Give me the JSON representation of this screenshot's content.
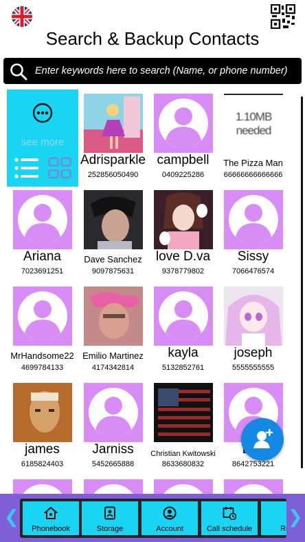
{
  "header": {
    "title": "Search & Backup Contacts",
    "language_icon": "uk-flag-icon",
    "qr_icon": "qr-code-icon"
  },
  "search": {
    "placeholder": "Enter keywords here to search (Name, or phone number)"
  },
  "see_more": {
    "label": "see more",
    "color": "#19d4f3"
  },
  "contacts": [
    {
      "name": "Adrisparkle",
      "phone": "252856050490",
      "photo": "photo"
    },
    {
      "name": "campbell",
      "phone": "0409225286",
      "photo": "default-avatar"
    },
    {
      "name": "The Pizza Man",
      "phone": "66666666666666",
      "photo": "photo"
    },
    {
      "name": "Ariana",
      "phone": "7023691251",
      "photo": "default-avatar"
    },
    {
      "name": "Dave Sanchez",
      "phone": "9097875631",
      "photo": "photo"
    },
    {
      "name": "love D.va",
      "phone": "9378779802",
      "photo": "photo"
    },
    {
      "name": "Sissy",
      "phone": "7066476574",
      "photo": "default-avatar"
    },
    {
      "name": "MrHandsome22",
      "phone": "4699784133",
      "photo": "default-avatar"
    },
    {
      "name": "Emilio Martinez",
      "phone": "4174342814",
      "photo": "photo"
    },
    {
      "name": "kayla",
      "phone": "5132852761",
      "photo": "default-avatar"
    },
    {
      "name": "joseph",
      "phone": "5555555555",
      "photo": "photo"
    },
    {
      "name": "james",
      "phone": "6185824403",
      "photo": "photo"
    },
    {
      "name": "Jarniss",
      "phone": "5452665888",
      "photo": "default-avatar"
    },
    {
      "name": "Christian Kwitowski",
      "phone": "8633680832",
      "photo": "photo"
    },
    {
      "name": "Ella",
      "phone": "8642753221",
      "photo": "default-avatar"
    }
  ],
  "photo_text": {
    "pizza": "1.10MB needed"
  },
  "bottom_nav": {
    "tabs": [
      {
        "label": "Phonebook",
        "icon": "home-icon"
      },
      {
        "label": "Storage",
        "icon": "storage-icon"
      },
      {
        "label": "Account",
        "icon": "account-icon"
      },
      {
        "label": "Call schedule",
        "icon": "calendar-clock-icon"
      },
      {
        "label": "Remi",
        "icon": "reminder-icon"
      }
    ],
    "left_arrow": "❮",
    "right_arrow": "❯",
    "background": "#7e5fd8",
    "tab_color": "#19d4f3"
  },
  "fab": {
    "icon": "add-contact-icon",
    "color": "#1389e6"
  },
  "colors": {
    "avatar_placeholder": "#d88cf6",
    "search_bar": "#000000"
  }
}
